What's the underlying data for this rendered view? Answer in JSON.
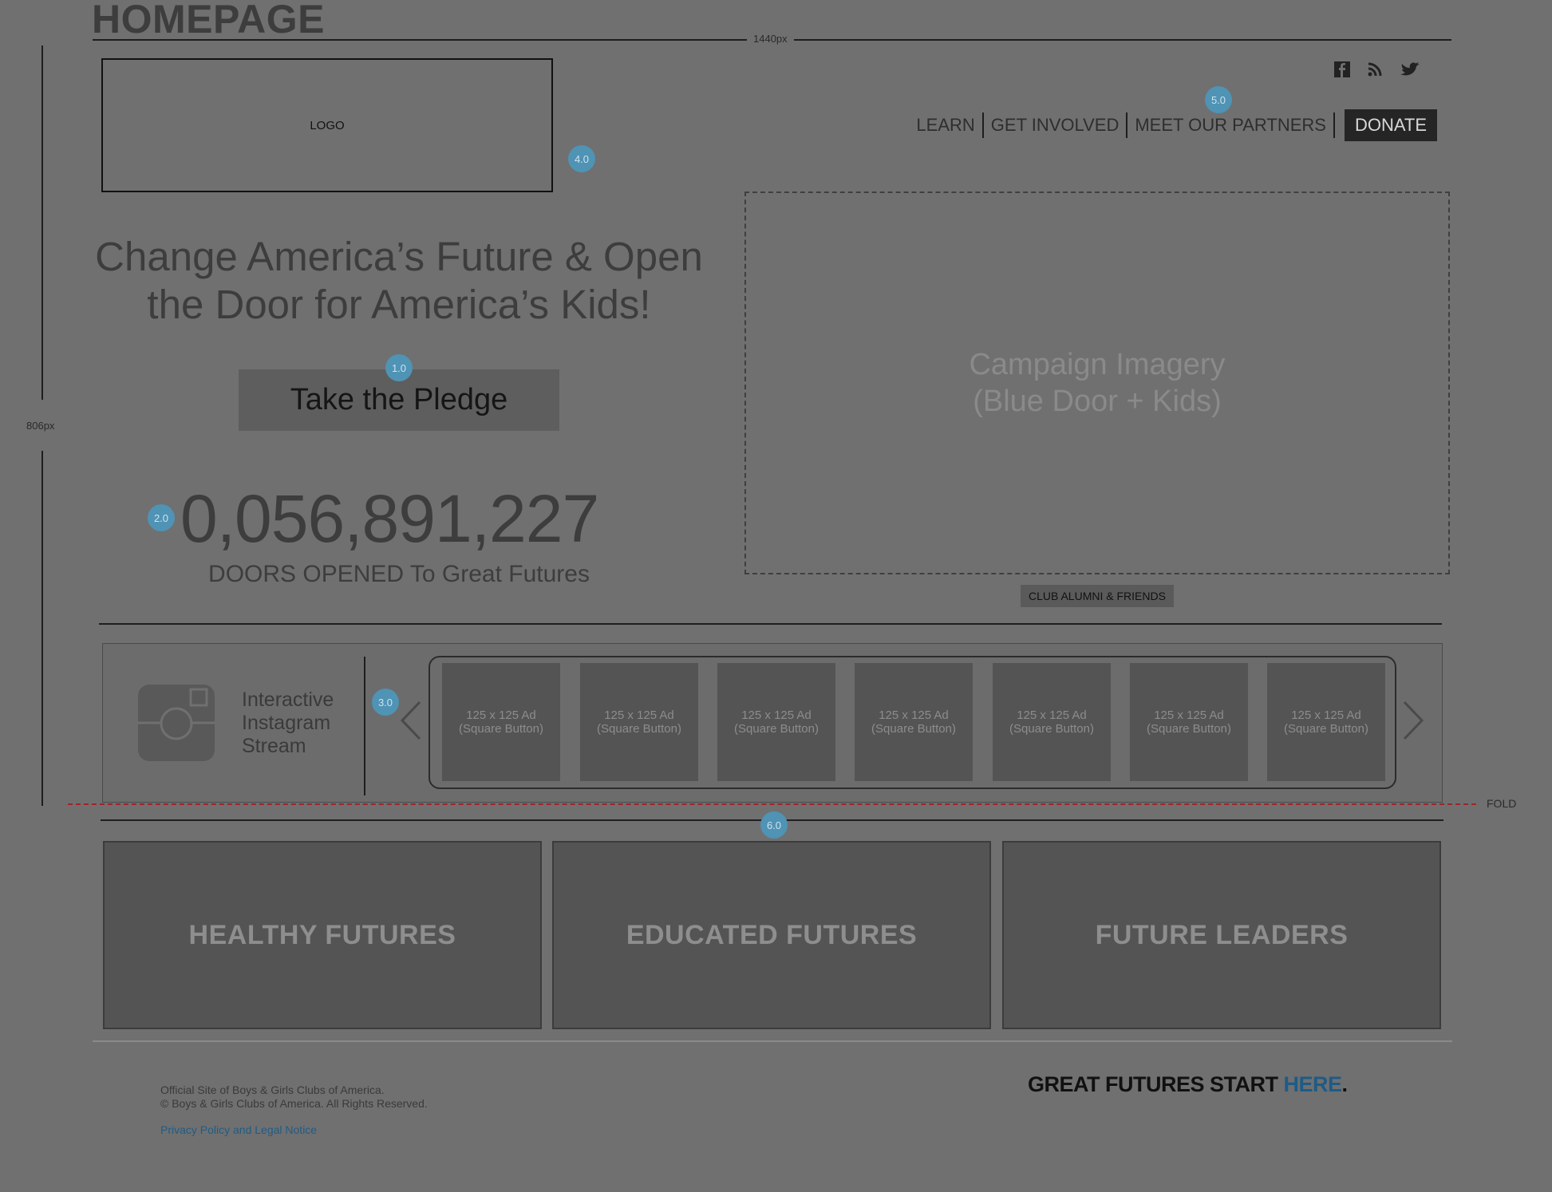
{
  "page": {
    "title": "HOMEPAGE"
  },
  "annotations": {
    "width_label": "1440px",
    "height_label": "806px",
    "fold_label": "FOLD",
    "badges": {
      "b1": "1.0",
      "b2": "2.0",
      "b3": "3.0",
      "b4": "4.0",
      "b5": "5.0",
      "b6": "6.0"
    },
    "badge_color": "#4f93b5",
    "fold_color": "#a0242a"
  },
  "header": {
    "logo_label": "LOGO",
    "social_icons": [
      "facebook-icon",
      "rss-icon",
      "twitter-icon"
    ],
    "nav": [
      "LEARN",
      "GET INVOLVED",
      "MEET OUR PARTNERS"
    ],
    "donate_label": "DONATE"
  },
  "hero": {
    "title_line1": "Change America’s Future & Open",
    "title_line2": "the Door for America’s Kids!",
    "pledge_button": "Take the Pledge",
    "counter": "0,056,891,227",
    "counter_caption": "DOORS OPENED To Great Futures",
    "campaign_line1": "Campaign Imagery",
    "campaign_line2": "(Blue Door + Kids)",
    "club_tag": "CLUB ALUMNI & FRIENDS"
  },
  "instagram": {
    "line1": "Interactive",
    "line2": "Instagram",
    "line3": "Stream",
    "ads": [
      {
        "line1": "125 x 125 Ad",
        "line2": "(Square Button)"
      },
      {
        "line1": "125 x 125 Ad",
        "line2": "(Square Button)"
      },
      {
        "line1": "125 x 125 Ad",
        "line2": "(Square Button)"
      },
      {
        "line1": "125 x 125 Ad",
        "line2": "(Square Button)"
      },
      {
        "line1": "125 x 125 Ad",
        "line2": "(Square Button)"
      },
      {
        "line1": "125 x 125 Ad",
        "line2": "(Square Button)"
      },
      {
        "line1": "125 x 125 Ad",
        "line2": "(Square Button)"
      }
    ]
  },
  "cards": [
    "HEALTHY FUTURES",
    "EDUCATED FUTURES",
    "FUTURE LEADERS"
  ],
  "footer": {
    "legal_line1": "Official Site of Boys & Girls Clubs of America.",
    "legal_line2": "© Boys & Girls Clubs of America. All Rights Reserved.",
    "privacy_link": "Privacy Policy and Legal Notice",
    "tagline_main": "GREAT FUTURES START ",
    "tagline_highlight": "HERE",
    "tagline_end": ".",
    "link_color": "#1f5b86"
  }
}
